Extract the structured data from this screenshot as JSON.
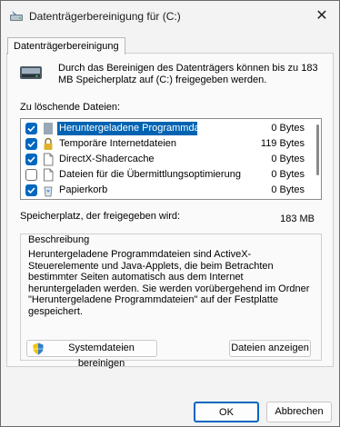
{
  "window": {
    "title": "Datenträgerbereinigung für  (C:)"
  },
  "tabs": [
    {
      "label": "Datenträgerbereinigung"
    }
  ],
  "intro_text": "Durch das Bereinigen des Datenträgers können bis zu 183 MB Speicherplatz auf  (C:) freigegeben werden.",
  "files_label": "Zu löschende Dateien:",
  "files": [
    {
      "name": "Heruntergeladene Programmdateien",
      "size": "0 Bytes",
      "checked": true,
      "selected": true,
      "icon": "blank-icon"
    },
    {
      "name": "Temporäre Internetdateien",
      "size": "119 Bytes",
      "checked": true,
      "selected": false,
      "icon": "lock-icon"
    },
    {
      "name": "DirectX-Shadercache",
      "size": "0 Bytes",
      "checked": true,
      "selected": false,
      "icon": "file-icon"
    },
    {
      "name": "Dateien für die Übermittlungsoptimierung",
      "size": "0 Bytes",
      "checked": false,
      "selected": false,
      "icon": "file-icon"
    },
    {
      "name": "Papierkorb",
      "size": "0 Bytes",
      "checked": true,
      "selected": false,
      "icon": "recycle-bin-icon"
    }
  ],
  "space_label": "Speicherplatz, der freigegeben wird:",
  "space_value": "183 MB",
  "description": {
    "title": "Beschreibung",
    "text": "Heruntergeladene Programmdateien sind ActiveX-Steuerelemente und Java-Applets, die beim Betrachten bestimmter Seiten automatisch aus dem Internet heruntergeladen werden. Sie werden vorübergehend im Ordner \"Heruntergeladene Programmdateien\" auf der Festplatte gespeichert."
  },
  "buttons": {
    "system_files": "Systemdateien bereinigen",
    "view_files": "Dateien anzeigen",
    "ok": "OK",
    "cancel": "Abbrechen"
  },
  "colors": {
    "accent": "#0067c0",
    "selection": "#0063b1"
  }
}
